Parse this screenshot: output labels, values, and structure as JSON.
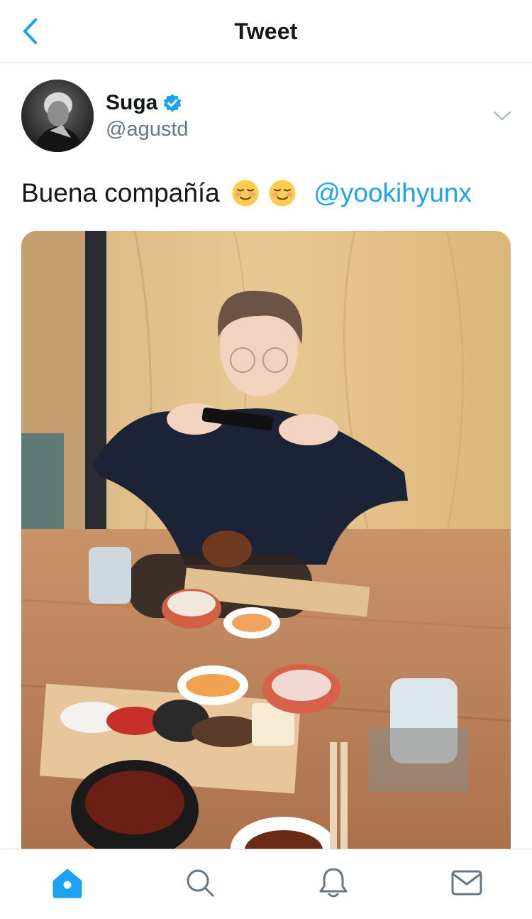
{
  "header": {
    "title": "Tweet",
    "back_icon": "chevron-left-icon"
  },
  "tweet": {
    "author": {
      "display_name": "Suga",
      "handle": "@agustd",
      "verified": true
    },
    "text": "Buena compañía",
    "emojis": [
      "☺️",
      "☺️"
    ],
    "mention": "@yookihyunx",
    "media_description": "photo"
  },
  "tabbar": {
    "items": [
      {
        "name": "home",
        "icon": "home-icon",
        "active": true
      },
      {
        "name": "search",
        "icon": "search-icon",
        "active": false
      },
      {
        "name": "notifications",
        "icon": "bell-icon",
        "active": false
      },
      {
        "name": "messages",
        "icon": "mail-icon",
        "active": false
      }
    ]
  },
  "colors": {
    "accent": "#1da1f2",
    "text_primary": "#14171a",
    "text_secondary": "#657786",
    "divider": "#d6d9db"
  }
}
